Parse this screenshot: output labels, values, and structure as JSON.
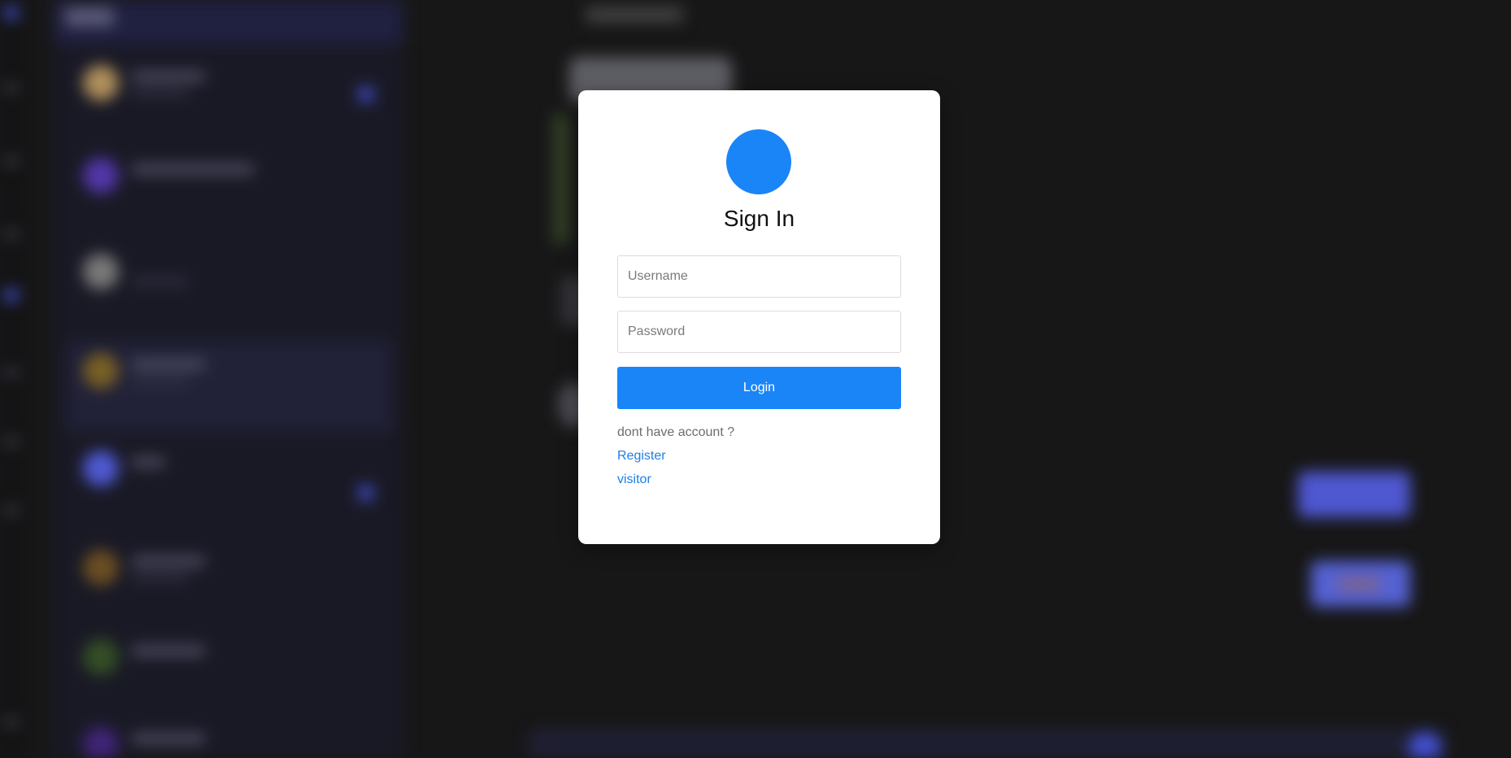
{
  "colors": {
    "accent": "#1a85f7",
    "link": "#1f7fe6",
    "backdrop": "#1b1b1c"
  },
  "login_modal": {
    "logo_icon": "circle-logo",
    "title": "Sign In",
    "username": {
      "value": "",
      "placeholder": "Username"
    },
    "password": {
      "value": "",
      "placeholder": "Password"
    },
    "login_label": "Login",
    "account_prompt": "dont have account ?",
    "register_label": "Register",
    "visitor_label": "visitor"
  }
}
